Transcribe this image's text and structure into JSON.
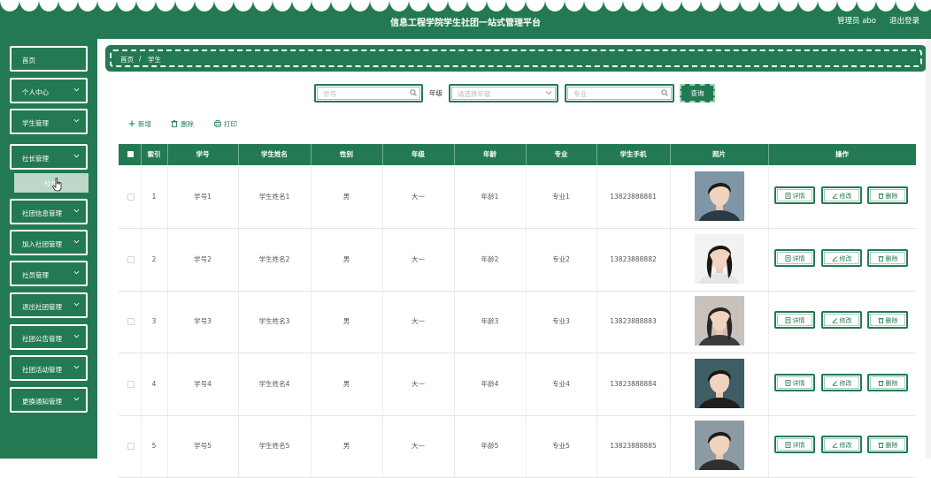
{
  "header": {
    "title": "信息工程学院学生社团一站式管理平台",
    "user": "管理员 abo",
    "logout": "退出登录"
  },
  "sidebar": {
    "items": [
      {
        "label": "首页",
        "has_chevron": false
      },
      {
        "label": "个人中心",
        "has_chevron": true
      },
      {
        "label": "学生管理",
        "has_chevron": true
      },
      {
        "label": "社长管理",
        "has_chevron": true
      },
      {
        "label": "社团信息管理",
        "has_chevron": true
      },
      {
        "label": "加入社团管理",
        "has_chevron": true
      },
      {
        "label": "社员管理",
        "has_chevron": true
      },
      {
        "label": "退出社团管理",
        "has_chevron": true
      },
      {
        "label": "社团公告管理",
        "has_chevron": true
      },
      {
        "label": "社团活动管理",
        "has_chevron": true
      },
      {
        "label": "更换通知管理",
        "has_chevron": true
      }
    ],
    "submenu": {
      "label": "社长"
    }
  },
  "breadcrumb": {
    "home": "首页",
    "separator": "/",
    "current": "学生"
  },
  "search": {
    "student_id_placeholder": "学号",
    "grade_label": "年级",
    "grade_placeholder": "请选择年级",
    "major_placeholder": "专业",
    "query_button": "查询"
  },
  "actions": {
    "add": "新增",
    "delete": "删除",
    "print": "打印"
  },
  "table": {
    "columns": [
      "索引",
      "学号",
      "学生姓名",
      "性别",
      "年级",
      "年龄",
      "专业",
      "学生手机",
      "照片",
      "操作"
    ],
    "rows": [
      {
        "index": "1",
        "student_id": "学号1",
        "name": "学生姓名1",
        "gender": "男",
        "grade": "大一",
        "age": "年龄1",
        "major": "专业1",
        "phone": "13823888881"
      },
      {
        "index": "2",
        "student_id": "学号2",
        "name": "学生姓名2",
        "gender": "男",
        "grade": "大一",
        "age": "年龄2",
        "major": "专业2",
        "phone": "13823888882"
      },
      {
        "index": "3",
        "student_id": "学号3",
        "name": "学生姓名3",
        "gender": "男",
        "grade": "大一",
        "age": "年龄3",
        "major": "专业3",
        "phone": "13823888883"
      },
      {
        "index": "4",
        "student_id": "学号4",
        "name": "学生姓名4",
        "gender": "男",
        "grade": "大一",
        "age": "年龄4",
        "major": "专业4",
        "phone": "13823888884"
      },
      {
        "index": "5",
        "student_id": "学号5",
        "name": "学生姓名5",
        "gender": "男",
        "grade": "大一",
        "age": "年龄5",
        "major": "专业5",
        "phone": "13823888885"
      }
    ],
    "op_labels": {
      "detail": "详情",
      "edit": "修改",
      "delete": "删除"
    }
  },
  "colors": {
    "primary": "#237a52",
    "header_text": "#ffffff"
  },
  "icons": {
    "search": "search-icon",
    "chevron": "chevron-down-icon",
    "add": "plus-icon",
    "delete": "trash-icon",
    "print": "printer-icon",
    "detail": "document-icon",
    "edit": "pencil-icon"
  }
}
